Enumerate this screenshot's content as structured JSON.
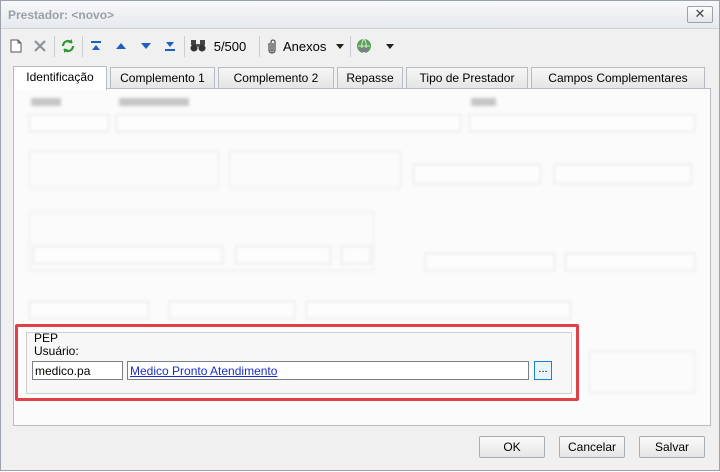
{
  "window": {
    "title": "Prestador: <novo>",
    "close_glyph": "✕"
  },
  "toolbar": {
    "new_icon": "new-document-icon",
    "delete_icon": "delete-icon",
    "refresh_icon": "refresh-icon",
    "first_icon": "first-record-icon",
    "prev_icon": "previous-record-icon",
    "next_icon": "next-record-icon",
    "last_icon": "last-record-icon",
    "find_icon": "binoculars-icon",
    "record_counter": "5/500",
    "attachments_label": "Anexos",
    "attachments_icon": "paperclip-icon",
    "extra_icon": "globe-icon"
  },
  "tabs": [
    {
      "label": "Identificação",
      "active": true
    },
    {
      "label": "Complemento 1",
      "active": false
    },
    {
      "label": "Complemento 2",
      "active": false
    },
    {
      "label": "Repasse",
      "active": false
    },
    {
      "label": "Tipo de Prestador",
      "active": false
    },
    {
      "label": "Campos Complementares",
      "active": false
    }
  ],
  "pep": {
    "group_title": "PEP",
    "user_label": "Usuário:",
    "login_value": "medico.pa",
    "user_name": "Medico Pronto Atendimento",
    "lookup_label": "..."
  },
  "buttons": {
    "ok": "OK",
    "cancel": "Cancelar",
    "save": "Salvar"
  },
  "colors": {
    "highlight": "#e04148",
    "link": "#1a2dc7",
    "lookup_border": "#1c7fd6"
  }
}
